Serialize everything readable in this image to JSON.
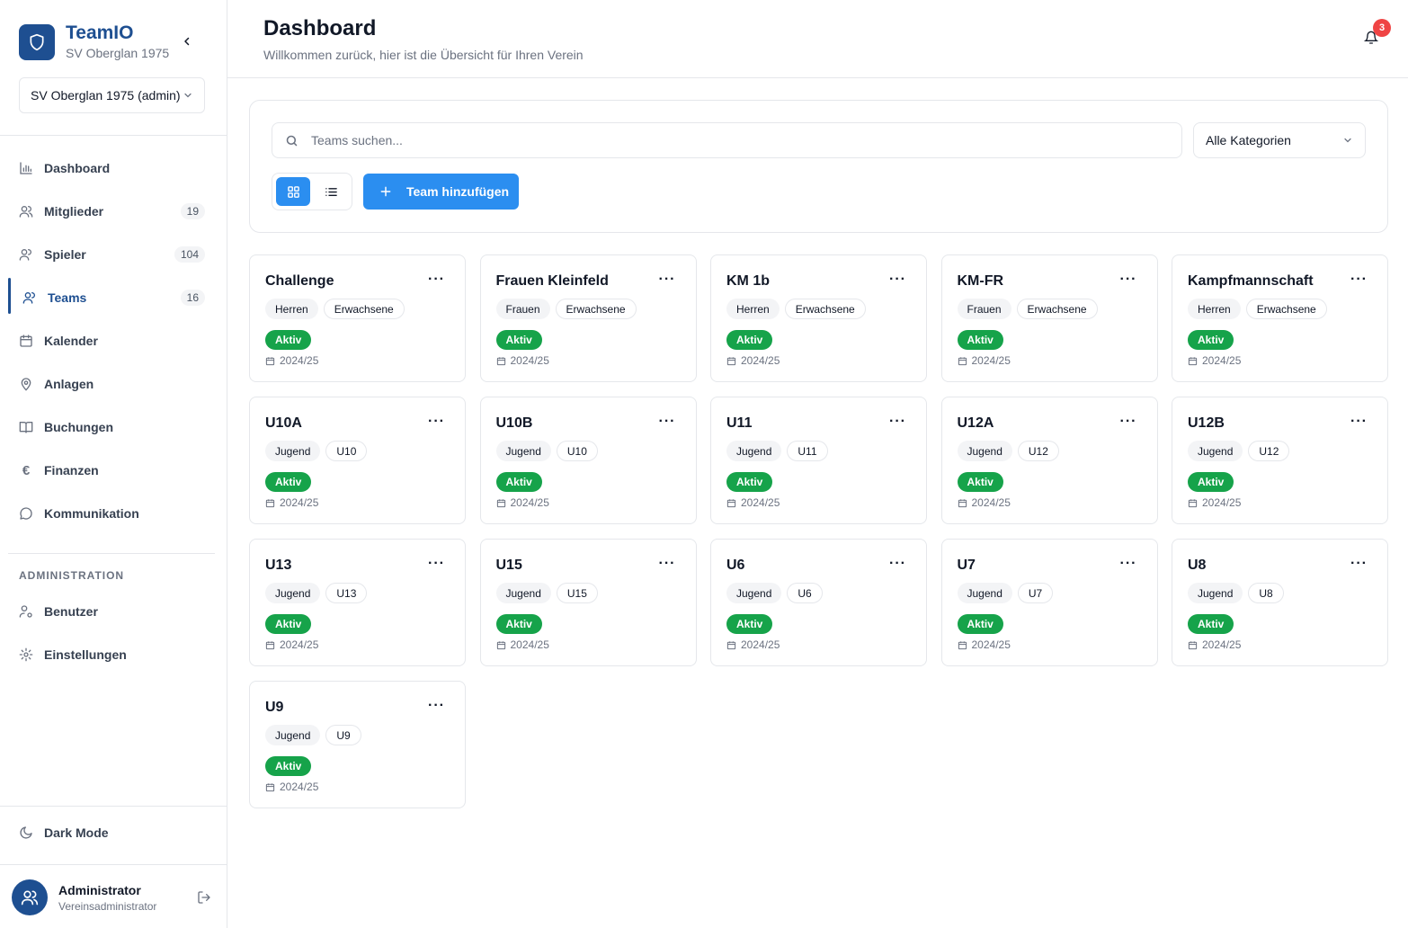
{
  "app": {
    "name": "TeamIO",
    "club_name": "SV Oberglan 1975",
    "club_selector": "SV Oberglan 1975 (admin)",
    "brand_color": "#1e4f91",
    "accent_color": "#2b8ef0"
  },
  "sidebar": {
    "items": [
      {
        "label": "Dashboard",
        "icon": "bar-chart-icon",
        "count": null,
        "active": false
      },
      {
        "label": "Mitglieder",
        "icon": "users-icon",
        "count": "19",
        "active": false
      },
      {
        "label": "Spieler",
        "icon": "user-icon",
        "count": "104",
        "active": false
      },
      {
        "label": "Teams",
        "icon": "team-icon",
        "count": "16",
        "active": true
      },
      {
        "label": "Kalender",
        "icon": "calendar-icon",
        "count": null,
        "active": false
      },
      {
        "label": "Anlagen",
        "icon": "map-pin-icon",
        "count": null,
        "active": false
      },
      {
        "label": "Buchungen",
        "icon": "book-icon",
        "count": null,
        "active": false
      },
      {
        "label": "Finanzen",
        "icon": "euro-icon",
        "count": null,
        "active": false
      },
      {
        "label": "Kommunikation",
        "icon": "chat-icon",
        "count": null,
        "active": false
      }
    ],
    "admin_heading": "ADMINISTRATION",
    "admin_items": [
      {
        "label": "Benutzer",
        "icon": "user-cog-icon"
      },
      {
        "label": "Einstellungen",
        "icon": "gear-icon"
      }
    ],
    "dark_mode_label": "Dark Mode",
    "user": {
      "name": "Administrator",
      "role": "Vereinsadministrator"
    }
  },
  "header": {
    "title": "Dashboard",
    "subtitle": "Willkommen zurück, hier ist die Übersicht für Ihren Verein",
    "notification_count": "3"
  },
  "filters": {
    "search_placeholder": "Teams suchen...",
    "category_selected": "Alle Kategorien",
    "add_button_label": "Team hinzufügen"
  },
  "teams": [
    {
      "name": "Challenge",
      "tag1": "Herren",
      "tag2": "Erwachsene",
      "status": "Aktiv",
      "season": "2024/25"
    },
    {
      "name": "Frauen Kleinfeld",
      "tag1": "Frauen",
      "tag2": "Erwachsene",
      "status": "Aktiv",
      "season": "2024/25"
    },
    {
      "name": "KM 1b",
      "tag1": "Herren",
      "tag2": "Erwachsene",
      "status": "Aktiv",
      "season": "2024/25"
    },
    {
      "name": "KM-FR",
      "tag1": "Frauen",
      "tag2": "Erwachsene",
      "status": "Aktiv",
      "season": "2024/25"
    },
    {
      "name": "Kampfmannschaft",
      "tag1": "Herren",
      "tag2": "Erwachsene",
      "status": "Aktiv",
      "season": "2024/25"
    },
    {
      "name": "U10A",
      "tag1": "Jugend",
      "tag2": "U10",
      "status": "Aktiv",
      "season": "2024/25"
    },
    {
      "name": "U10B",
      "tag1": "Jugend",
      "tag2": "U10",
      "status": "Aktiv",
      "season": "2024/25"
    },
    {
      "name": "U11",
      "tag1": "Jugend",
      "tag2": "U11",
      "status": "Aktiv",
      "season": "2024/25"
    },
    {
      "name": "U12A",
      "tag1": "Jugend",
      "tag2": "U12",
      "status": "Aktiv",
      "season": "2024/25"
    },
    {
      "name": "U12B",
      "tag1": "Jugend",
      "tag2": "U12",
      "status": "Aktiv",
      "season": "2024/25"
    },
    {
      "name": "U13",
      "tag1": "Jugend",
      "tag2": "U13",
      "status": "Aktiv",
      "season": "2024/25"
    },
    {
      "name": "U15",
      "tag1": "Jugend",
      "tag2": "U15",
      "status": "Aktiv",
      "season": "2024/25"
    },
    {
      "name": "U6",
      "tag1": "Jugend",
      "tag2": "U6",
      "status": "Aktiv",
      "season": "2024/25"
    },
    {
      "name": "U7",
      "tag1": "Jugend",
      "tag2": "U7",
      "status": "Aktiv",
      "season": "2024/25"
    },
    {
      "name": "U8",
      "tag1": "Jugend",
      "tag2": "U8",
      "status": "Aktiv",
      "season": "2024/25"
    },
    {
      "name": "U9",
      "tag1": "Jugend",
      "tag2": "U9",
      "status": "Aktiv",
      "season": "2024/25"
    }
  ]
}
